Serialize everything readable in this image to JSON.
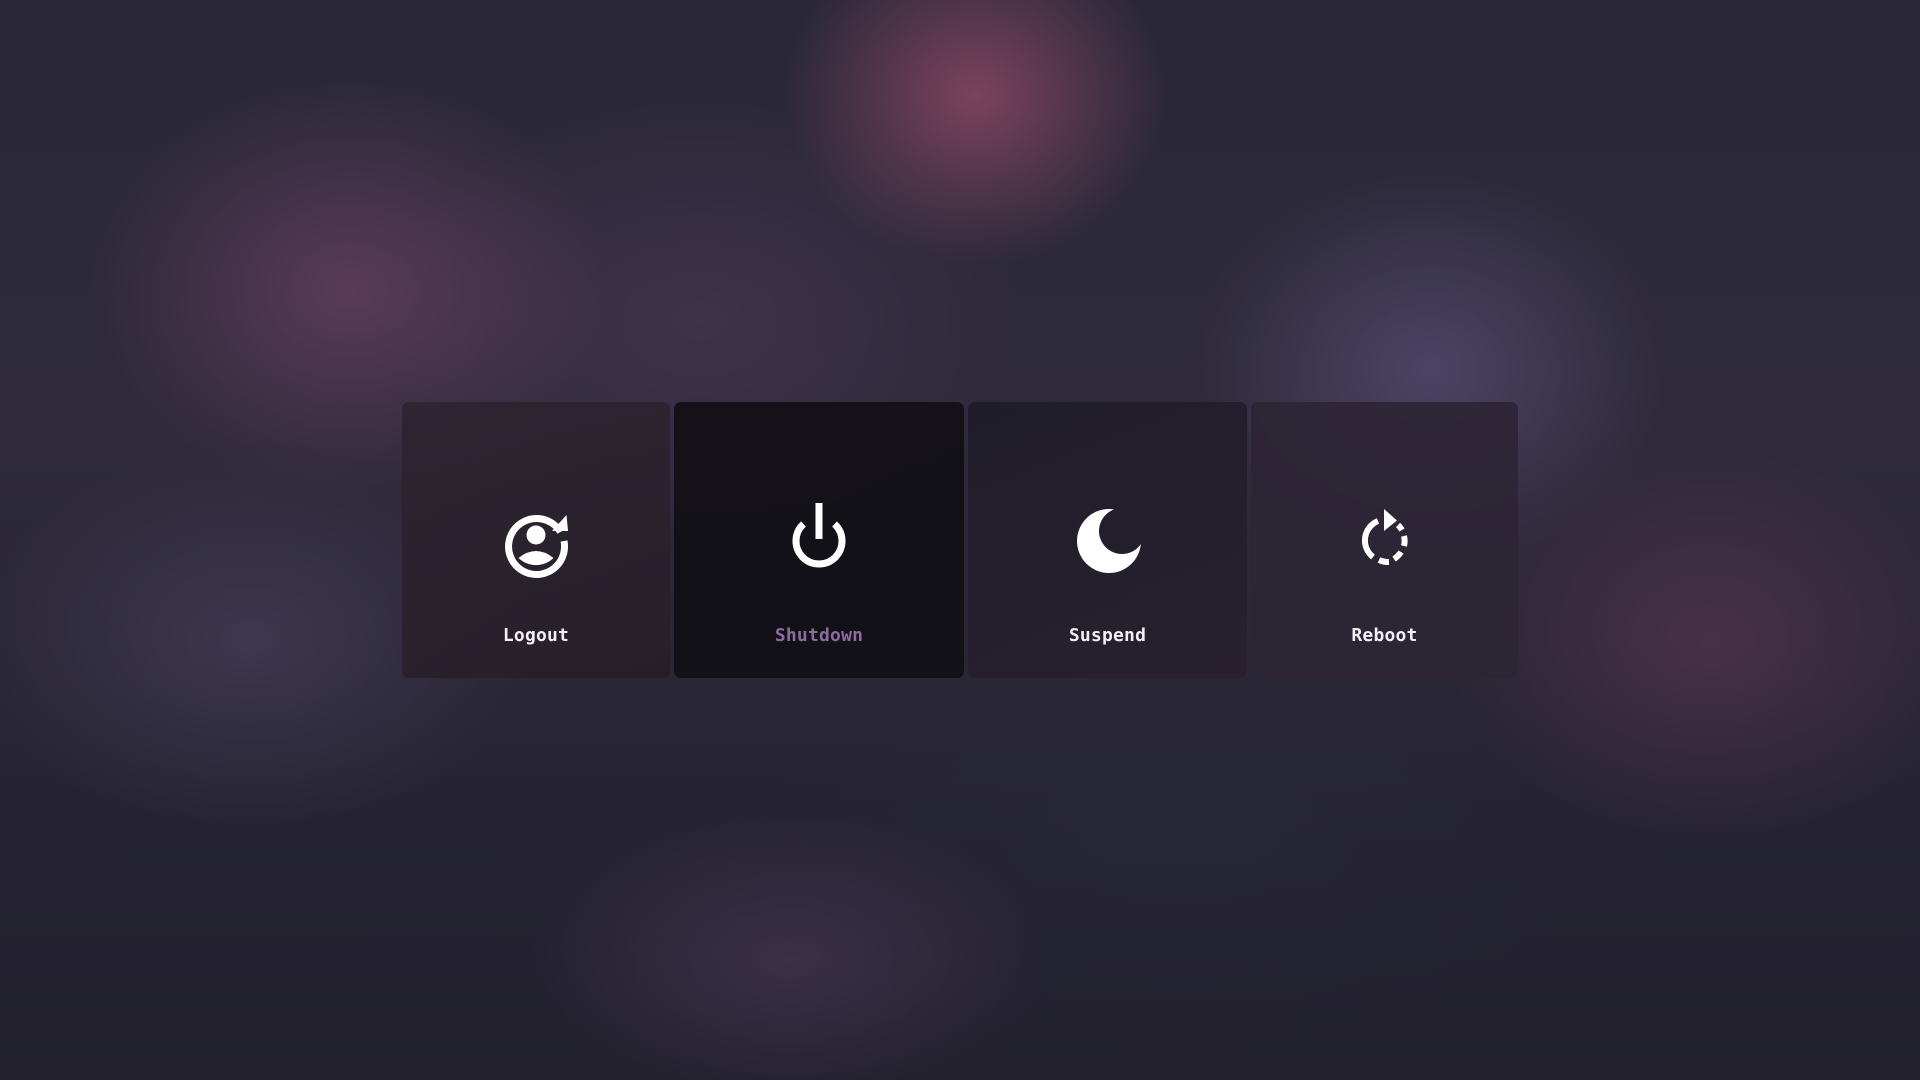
{
  "power_menu": {
    "options": [
      {
        "id": "logout",
        "label": "Logout",
        "icon": "logout-icon"
      },
      {
        "id": "shutdown",
        "label": "Shutdown",
        "icon": "power-icon",
        "selected": true
      },
      {
        "id": "suspend",
        "label": "Suspend",
        "icon": "moon-icon"
      },
      {
        "id": "reboot",
        "label": "Reboot",
        "icon": "reboot-icon"
      }
    ]
  },
  "colors": {
    "label": "#f2eef4",
    "selected_label": "#8e6a9e",
    "icon": "#ffffff",
    "selected_tile": "#131117"
  }
}
